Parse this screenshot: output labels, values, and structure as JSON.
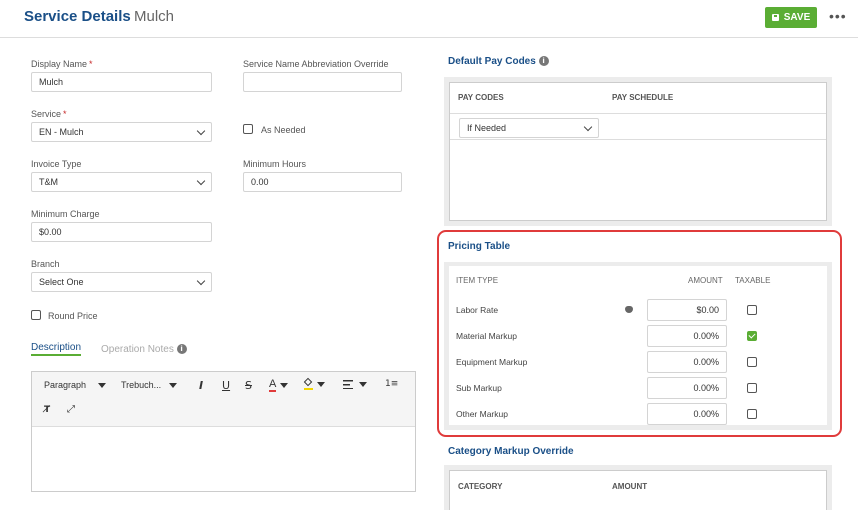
{
  "header": {
    "title": "Service Details",
    "subtitle": "Mulch",
    "save_label": "SAVE",
    "more_label": "•••"
  },
  "form": {
    "display_name": {
      "label": "Display Name",
      "required": "*",
      "value": "Mulch"
    },
    "abbrev": {
      "label": "Service Name Abbreviation Override",
      "value": ""
    },
    "service": {
      "label": "Service",
      "required": "*",
      "value": "EN - Mulch"
    },
    "as_needed": {
      "label": "As Needed",
      "checked": false
    },
    "invoice_type": {
      "label": "Invoice Type",
      "value": "T&M"
    },
    "min_hours": {
      "label": "Minimum Hours",
      "value": "0.00"
    },
    "min_charge": {
      "label": "Minimum Charge",
      "value": "$0.00"
    },
    "branch": {
      "label": "Branch",
      "value": "Select One"
    },
    "round_price": {
      "label": "Round Price",
      "checked": false
    }
  },
  "tabs": {
    "description": "Description",
    "operation_notes": "Operation Notes"
  },
  "editor": {
    "paragraph": "Paragraph",
    "font": "Trebuch...",
    "italic": "I",
    "underline": "U",
    "strike": "S",
    "font_color": "A"
  },
  "pay_codes": {
    "title": "Default Pay Codes",
    "col_pay_codes": "PAY CODES",
    "col_pay_schedule": "PAY SCHEDULE",
    "schedule_value": "If Needed"
  },
  "pricing": {
    "title": "Pricing Table",
    "col_item": "ITEM TYPE",
    "col_amount": "AMOUNT",
    "col_taxable": "TAXABLE",
    "rows": [
      {
        "label": "Labor Rate",
        "amount": "$0.00",
        "taxable": false
      },
      {
        "label": "Material Markup",
        "amount": "0.00%",
        "taxable": true
      },
      {
        "label": "Equipment Markup",
        "amount": "0.00%",
        "taxable": false
      },
      {
        "label": "Sub Markup",
        "amount": "0.00%",
        "taxable": false
      },
      {
        "label": "Other Markup",
        "amount": "0.00%",
        "taxable": false
      }
    ]
  },
  "category_override": {
    "title": "Category Markup Override",
    "col_category": "CATEGORY",
    "col_amount": "AMOUNT"
  },
  "colors": {
    "brand_blue": "#1a4f87",
    "accent_green": "#5aad34",
    "highlight_red": "#e03b3b"
  }
}
